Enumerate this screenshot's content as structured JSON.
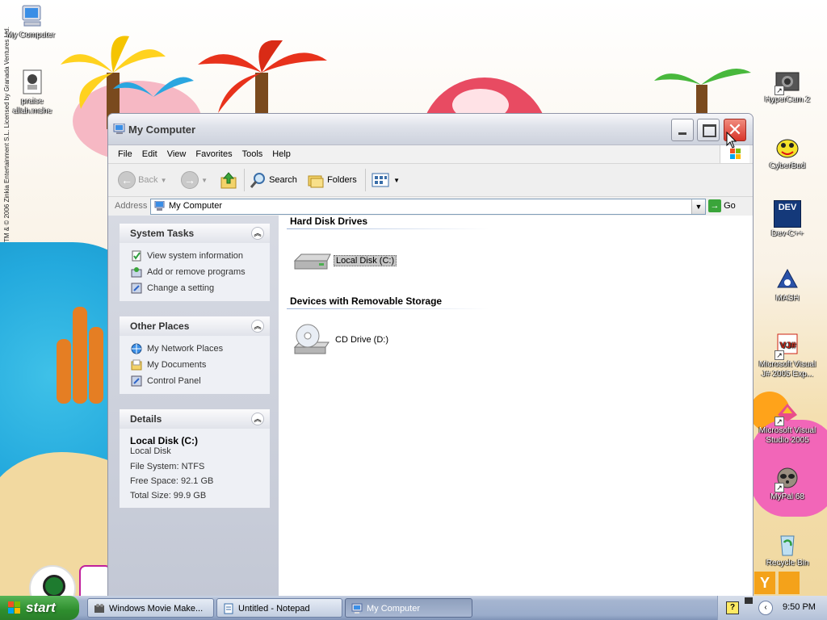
{
  "desktop": {
    "copyright_text": "TM & © 2006 Zinkia Entertainment S.L. Licensed by Granada Ventures Ltd.",
    "icons": [
      {
        "label": "My Computer"
      },
      {
        "label": "praise allah.mshe"
      },
      {
        "label": "HyperCam 2"
      },
      {
        "label": "CyberBud"
      },
      {
        "label": "Dev-C++"
      },
      {
        "label": "MASH"
      },
      {
        "label": "Microsoft Visual J# 2005 Exp..."
      },
      {
        "label": "Microsoft Visual Studio 2005"
      },
      {
        "label": "MyPal 68"
      },
      {
        "label": "Recycle Bin"
      }
    ],
    "dev_icon_text": "DEV"
  },
  "window": {
    "title": "My Computer",
    "close_glyph": "✕",
    "menu": [
      "File",
      "Edit",
      "View",
      "Favorites",
      "Tools",
      "Help"
    ],
    "toolbar": {
      "back_label": "Back",
      "search_label": "Search",
      "folders_label": "Folders"
    },
    "address": {
      "label": "Address",
      "value": "My Computer",
      "go_label": "Go"
    },
    "task_pane": {
      "system_tasks": {
        "title": "System Tasks",
        "links": [
          "View system information",
          "Add or remove programs",
          "Change a setting"
        ]
      },
      "other_places": {
        "title": "Other Places",
        "links": [
          "My Network Places",
          "My Documents",
          "Control Panel"
        ]
      },
      "details": {
        "title": "Details",
        "name": "Local Disk (C:)",
        "type": "Local Disk",
        "file_system": "File System: NTFS",
        "free_space": "Free Space: 92.1 GB",
        "total_size": "Total Size: 99.9 GB"
      }
    },
    "main": {
      "groups": [
        {
          "title": "Hard Disk Drives",
          "items": [
            {
              "label": "Local Disk (C:)",
              "selected": true
            }
          ]
        },
        {
          "title": "Devices with Removable Storage",
          "items": [
            {
              "label": "CD Drive (D:)",
              "selected": false
            }
          ]
        }
      ]
    }
  },
  "taskbar": {
    "start_label": "start",
    "tasks": [
      {
        "label": "Windows Movie Make...",
        "active": false
      },
      {
        "label": "Untitled - Notepad",
        "active": false
      },
      {
        "label": "My Computer",
        "active": true
      }
    ],
    "clock": "9:50 PM",
    "help_glyph": "?"
  },
  "colors": {
    "accent_blue": "#2e64c8",
    "start_green": "#2e8e2e",
    "close_red": "#d9352a"
  }
}
